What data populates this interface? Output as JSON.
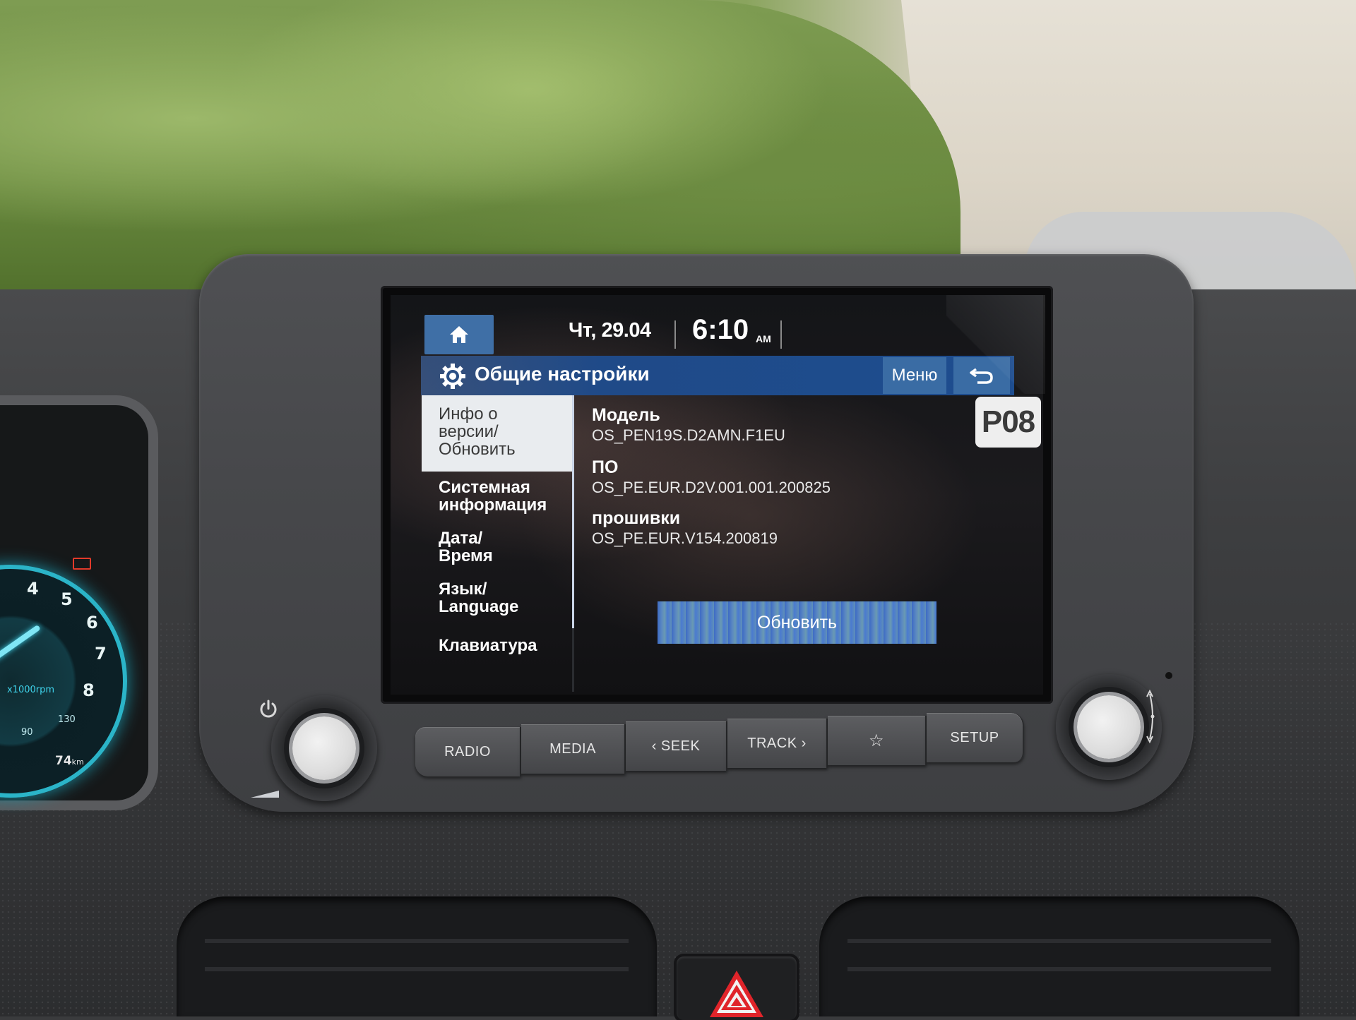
{
  "status_bar": {
    "date": "Чт, 29.04",
    "time": "6:10",
    "ampm": "AM"
  },
  "header": {
    "title": "Общие настройки",
    "icon": "gear-icon",
    "menu_label": "Меню",
    "back_icon": "back-arrow-icon",
    "home_icon": "home-icon"
  },
  "sidebar": {
    "items": [
      {
        "label": "Инфо о версии/ Обновить",
        "selected": true
      },
      {
        "label": "Системная информация",
        "selected": false
      },
      {
        "label": "Дата/ Время",
        "selected": false
      },
      {
        "label": "Язык/ Language",
        "selected": false
      },
      {
        "label": "Клавиатура",
        "selected": false
      }
    ]
  },
  "content": {
    "model_label": "Модель",
    "model_value": "OS_PEN19S.D2AMN.F1EU",
    "software_label": "ПО",
    "software_value": "OS_PE.EUR.D2V.001.001.200825",
    "firmware_label": "прошивки",
    "firmware_value": "OS_PE.EUR.V154.200819",
    "update_button": "Обновить",
    "badge": "P08"
  },
  "hardware_buttons": [
    {
      "label": "RADIO"
    },
    {
      "label": "MEDIA"
    },
    {
      "label": "‹ SEEK"
    },
    {
      "label": "TRACK ›"
    },
    {
      "label": "☆",
      "icon": "star-icon"
    },
    {
      "label": "SETUP"
    }
  ],
  "cluster": {
    "rpm_unit": "x1000rpm",
    "rpm_ticks": [
      "4",
      "5",
      "6",
      "7",
      "8"
    ],
    "temp_label": "90",
    "temp_max": "130",
    "range_value": "74",
    "range_unit": "km"
  },
  "colors": {
    "accent_blue": "#3a6ca4",
    "title_bar": "#1e4d8f",
    "selected_item_bg": "#e9ecef",
    "warning_red": "#e23a2a",
    "gauge_cyan": "#2bb4c8"
  }
}
